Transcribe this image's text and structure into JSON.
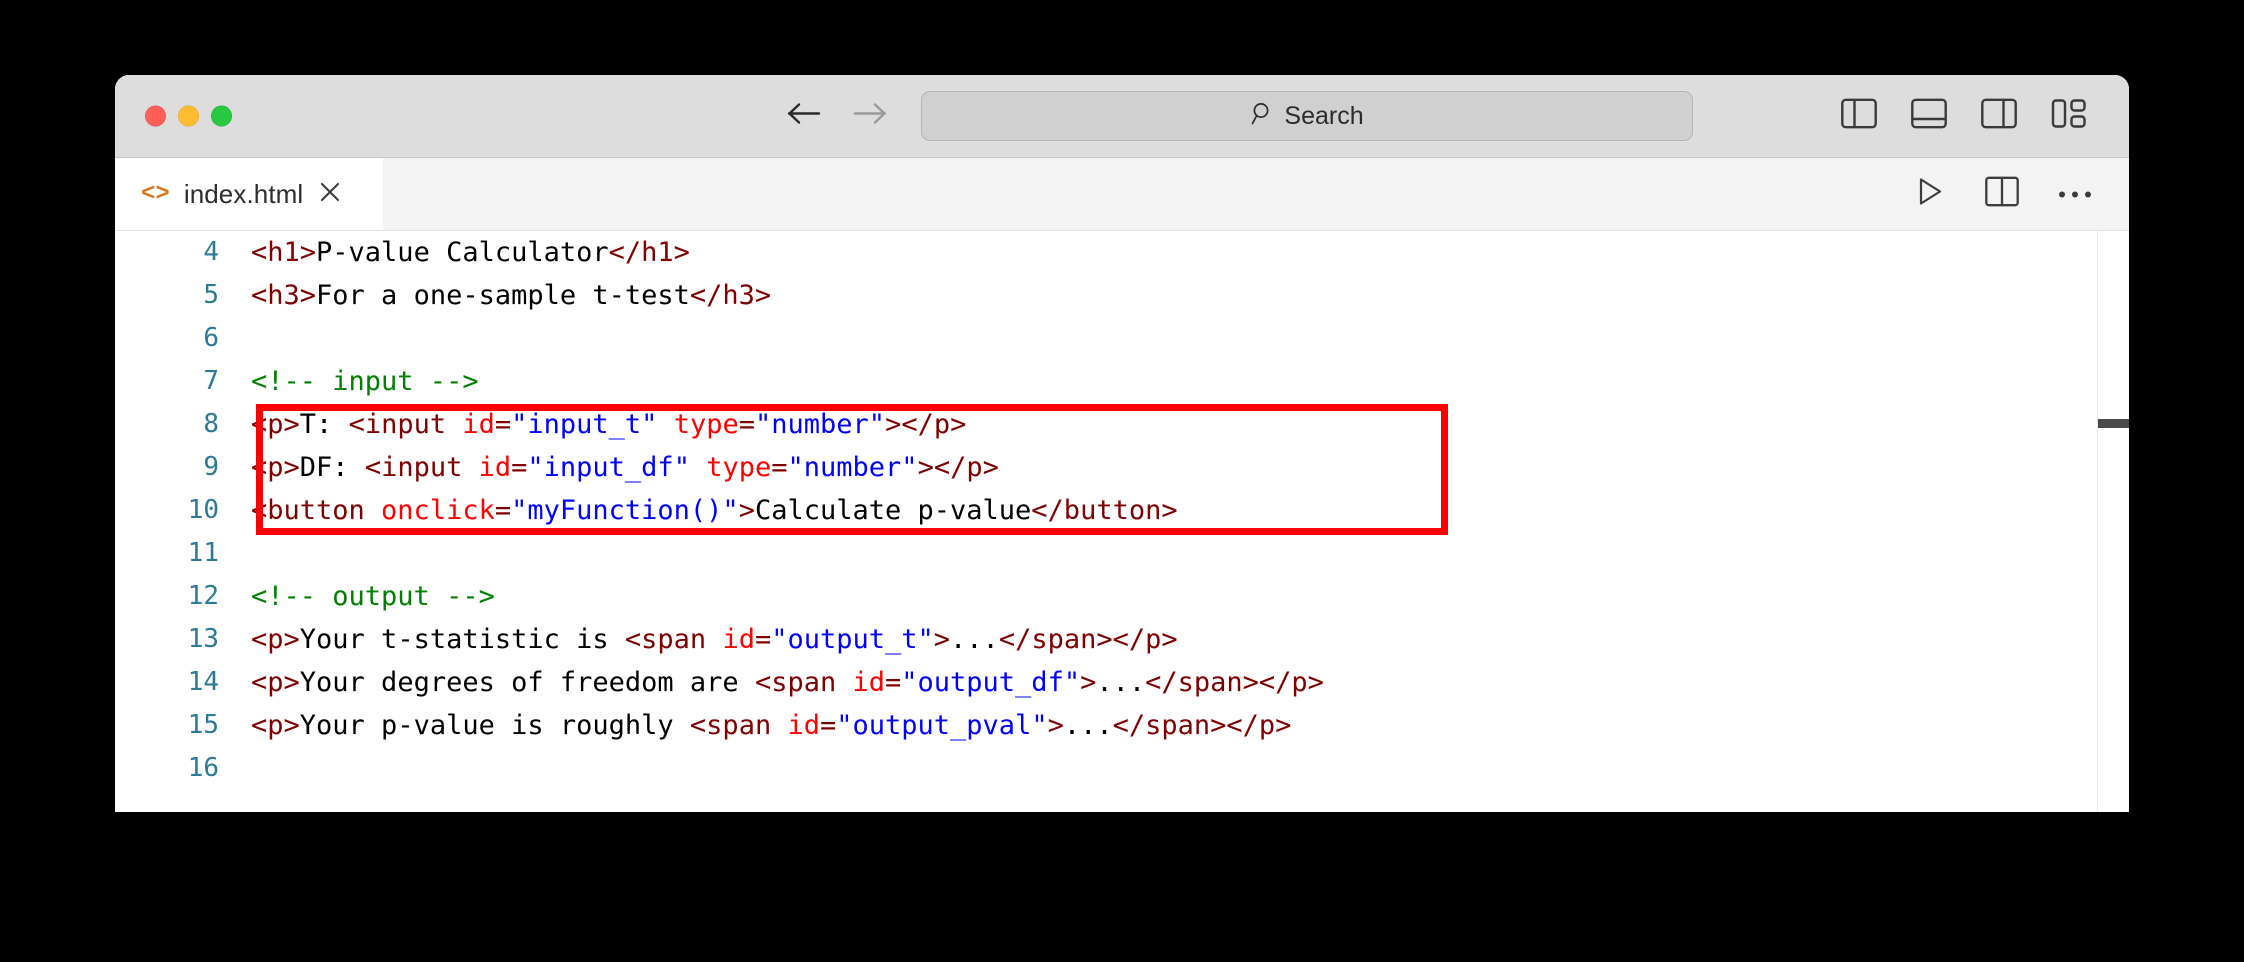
{
  "window": {
    "traffic_lights": [
      {
        "name": "close",
        "color": "#ff5f57"
      },
      {
        "name": "minimize",
        "color": "#febc2e"
      },
      {
        "name": "maximize",
        "color": "#28c840"
      }
    ]
  },
  "toolbar": {
    "back_icon": "arrow-left-icon",
    "forward_icon": "arrow-right-icon",
    "search": {
      "icon": "search-icon",
      "placeholder": "Search",
      "value": ""
    },
    "layout_icons": [
      "toggle-primary-sidebar-icon",
      "toggle-panel-icon",
      "toggle-secondary-sidebar-icon",
      "customize-layout-icon"
    ]
  },
  "tabs": [
    {
      "icon": "html-file-icon",
      "icon_glyph": "<>",
      "label": "index.html",
      "close_glyph": "✕",
      "active": true
    }
  ],
  "tab_actions": [
    {
      "name": "run-button",
      "icon": "play-triangle-icon"
    },
    {
      "name": "split-editor-button",
      "icon": "split-editor-icon"
    },
    {
      "name": "more-actions-button",
      "icon": "ellipsis-icon"
    }
  ],
  "editor": {
    "language": "html",
    "first_visible_line": 4,
    "last_visible_line": 16,
    "syntax_colors": {
      "tag": "#800000",
      "attribute": "#ff0000",
      "value": "#0000ff",
      "comment": "#008000",
      "text": "#000000",
      "line_number": "#2d7a96"
    },
    "highlight": {
      "color": "#ff0000",
      "lines": [
        13,
        14,
        15
      ]
    },
    "lines": [
      {
        "number": "4",
        "tokens": [
          {
            "t": "tag",
            "s": "<h1>"
          },
          {
            "t": "text",
            "s": "P-value Calculator"
          },
          {
            "t": "tag",
            "s": "</h1>"
          }
        ]
      },
      {
        "number": "5",
        "tokens": [
          {
            "t": "tag",
            "s": "<h3>"
          },
          {
            "t": "text",
            "s": "For a one-sample t-test"
          },
          {
            "t": "tag",
            "s": "</h3>"
          }
        ]
      },
      {
        "number": "6",
        "tokens": []
      },
      {
        "number": "7",
        "tokens": [
          {
            "t": "comment",
            "s": "<!-- input -->"
          }
        ]
      },
      {
        "number": "8",
        "tokens": [
          {
            "t": "tag",
            "s": "<p>"
          },
          {
            "t": "text",
            "s": "T: "
          },
          {
            "t": "tag",
            "s": "<input "
          },
          {
            "t": "attr",
            "s": "id"
          },
          {
            "t": "tag",
            "s": "="
          },
          {
            "t": "val",
            "s": "\"input_t\""
          },
          {
            "t": "tag",
            "s": " "
          },
          {
            "t": "attr",
            "s": "type"
          },
          {
            "t": "tag",
            "s": "="
          },
          {
            "t": "val",
            "s": "\"number\""
          },
          {
            "t": "tag",
            "s": "></p>"
          }
        ]
      },
      {
        "number": "9",
        "tokens": [
          {
            "t": "tag",
            "s": "<p>"
          },
          {
            "t": "text",
            "s": "DF: "
          },
          {
            "t": "tag",
            "s": "<input "
          },
          {
            "t": "attr",
            "s": "id"
          },
          {
            "t": "tag",
            "s": "="
          },
          {
            "t": "val",
            "s": "\"input_df\""
          },
          {
            "t": "tag",
            "s": " "
          },
          {
            "t": "attr",
            "s": "type"
          },
          {
            "t": "tag",
            "s": "="
          },
          {
            "t": "val",
            "s": "\"number\""
          },
          {
            "t": "tag",
            "s": "></p>"
          }
        ]
      },
      {
        "number": "10",
        "tokens": [
          {
            "t": "tag",
            "s": "<button "
          },
          {
            "t": "attr",
            "s": "onclick"
          },
          {
            "t": "tag",
            "s": "="
          },
          {
            "t": "val",
            "s": "\"myFunction()\""
          },
          {
            "t": "tag",
            "s": ">"
          },
          {
            "t": "text",
            "s": "Calculate p-value"
          },
          {
            "t": "tag",
            "s": "</button>"
          }
        ]
      },
      {
        "number": "11",
        "tokens": []
      },
      {
        "number": "12",
        "tokens": [
          {
            "t": "comment",
            "s": "<!-- output -->"
          }
        ]
      },
      {
        "number": "13",
        "tokens": [
          {
            "t": "tag",
            "s": "<p>"
          },
          {
            "t": "text",
            "s": "Your t-statistic is "
          },
          {
            "t": "tag",
            "s": "<span "
          },
          {
            "t": "attr",
            "s": "id"
          },
          {
            "t": "tag",
            "s": "="
          },
          {
            "t": "val",
            "s": "\"output_t\""
          },
          {
            "t": "tag",
            "s": ">"
          },
          {
            "t": "text",
            "s": "..."
          },
          {
            "t": "tag",
            "s": "</span></p>"
          }
        ]
      },
      {
        "number": "14",
        "tokens": [
          {
            "t": "tag",
            "s": "<p>"
          },
          {
            "t": "text",
            "s": "Your degrees of freedom are "
          },
          {
            "t": "tag",
            "s": "<span "
          },
          {
            "t": "attr",
            "s": "id"
          },
          {
            "t": "tag",
            "s": "="
          },
          {
            "t": "val",
            "s": "\"output_df\""
          },
          {
            "t": "tag",
            "s": ">"
          },
          {
            "t": "text",
            "s": "..."
          },
          {
            "t": "tag",
            "s": "</span></p>"
          }
        ]
      },
      {
        "number": "15",
        "tokens": [
          {
            "t": "tag",
            "s": "<p>"
          },
          {
            "t": "text",
            "s": "Your p-value is roughly "
          },
          {
            "t": "tag",
            "s": "<span "
          },
          {
            "t": "attr",
            "s": "id"
          },
          {
            "t": "tag",
            "s": "="
          },
          {
            "t": "val",
            "s": "\"output_pval\""
          },
          {
            "t": "tag",
            "s": ">"
          },
          {
            "t": "text",
            "s": "..."
          },
          {
            "t": "tag",
            "s": "</span></p>"
          }
        ]
      },
      {
        "number": "16",
        "tokens": []
      }
    ]
  }
}
